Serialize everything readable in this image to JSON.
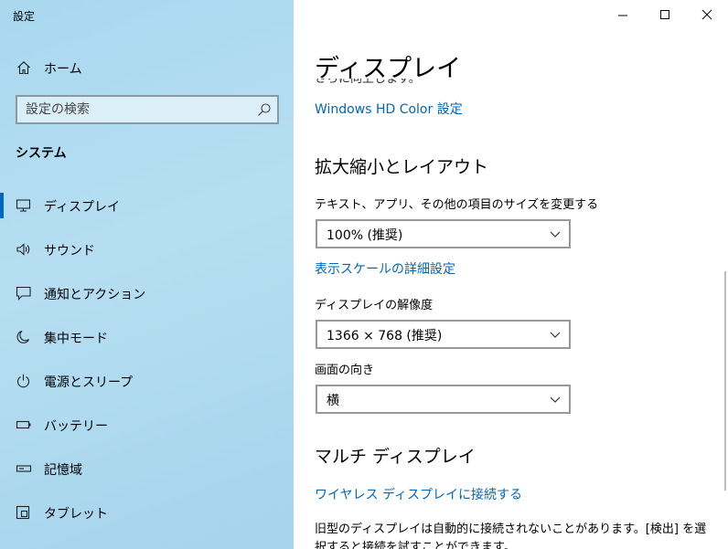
{
  "window": {
    "title": "設定"
  },
  "sidebar": {
    "home_label": "ホーム",
    "search_placeholder": "設定の検索",
    "section_title": "システム",
    "items": [
      {
        "label": "ディスプレイ",
        "icon": "monitor-icon",
        "active": true
      },
      {
        "label": "サウンド",
        "icon": "speaker-icon"
      },
      {
        "label": "通知とアクション",
        "icon": "notification-icon"
      },
      {
        "label": "集中モード",
        "icon": "moon-icon"
      },
      {
        "label": "電源とスリープ",
        "icon": "power-icon"
      },
      {
        "label": "バッテリー",
        "icon": "battery-icon"
      },
      {
        "label": "記憶域",
        "icon": "storage-icon"
      },
      {
        "label": "タブレット",
        "icon": "tablet-icon"
      }
    ]
  },
  "main": {
    "page_title": "ディスプレイ",
    "cutoff_text": "さらに向上します。",
    "hd_color_link": "Windows HD Color 設定",
    "scale_section": {
      "heading": "拡大縮小とレイアウト",
      "text_size_label": "テキスト、アプリ、その他の項目のサイズを変更する",
      "text_size_value": "100% (推奨)",
      "advanced_scale_link": "表示スケールの詳細設定",
      "resolution_label": "ディスプレイの解像度",
      "resolution_value": "1366 × 768 (推奨)",
      "orientation_label": "画面の向き",
      "orientation_value": "横"
    },
    "multi_section": {
      "heading": "マルチ ディスプレイ",
      "wireless_link": "ワイヤレス ディスプレイに接続する",
      "info_text": "旧型のディスプレイは自動的に接続されないことがあります。[検出] を選択すると接続を試すことができます。"
    }
  },
  "colors": {
    "accent": "#0067c0",
    "link": "#0067b8",
    "sidebar_bg": "#b0dbf1"
  }
}
